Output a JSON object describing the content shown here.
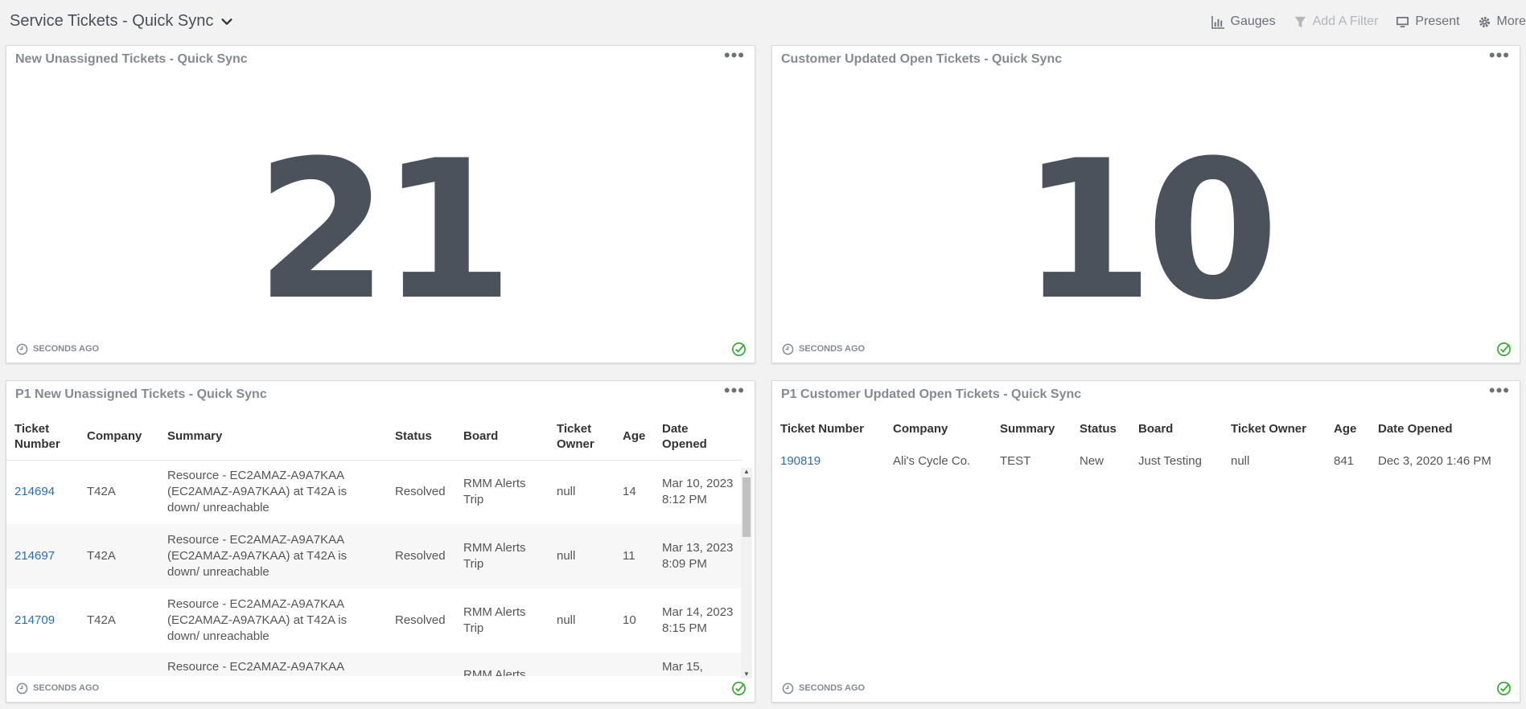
{
  "header": {
    "dashboard_title": "Service Tickets - Quick Sync",
    "toolbar": {
      "gauges": "Gauges",
      "add_filter": "Add A Filter",
      "present": "Present",
      "more": "More"
    }
  },
  "cards": {
    "new_unassigned": {
      "title": "New Unassigned Tickets - Quick Sync",
      "value": "21",
      "updated": "SECONDS AGO"
    },
    "customer_updated": {
      "title": "Customer Updated Open Tickets - Quick Sync",
      "value": "10",
      "updated": "SECONDS AGO"
    },
    "p1_new_unassigned": {
      "title": "P1 New Unassigned Tickets - Quick Sync",
      "updated": "SECONDS AGO",
      "columns": [
        "Ticket Number",
        "Company",
        "Summary",
        "Status",
        "Board",
        "Ticket Owner",
        "Age",
        "Date Opened"
      ],
      "rows": [
        [
          "214694",
          "T42A",
          "Resource - EC2AMAZ-A9A7KAA (EC2AMAZ-A9A7KAA) at T42A is down/ unreachable",
          "Resolved",
          "RMM Alerts Trip",
          "null",
          "14",
          "Mar 10, 2023 8:12 PM"
        ],
        [
          "214697",
          "T42A",
          "Resource - EC2AMAZ-A9A7KAA (EC2AMAZ-A9A7KAA) at T42A is down/ unreachable",
          "Resolved",
          "RMM Alerts Trip",
          "null",
          "11",
          "Mar 13, 2023 8:09 PM"
        ],
        [
          "214709",
          "T42A",
          "Resource - EC2AMAZ-A9A7KAA (EC2AMAZ-A9A7KAA) at T42A is down/ unreachable",
          "Resolved",
          "RMM Alerts Trip",
          "null",
          "10",
          "Mar 14, 2023 8:15 PM"
        ],
        [
          "",
          "",
          "Resource - EC2AMAZ-A9A7KAA",
          "",
          "RMM Alerts",
          "",
          "",
          "Mar 15,"
        ]
      ]
    },
    "p1_customer_updated": {
      "title": "P1 Customer Updated Open Tickets - Quick Sync",
      "updated": "SECONDS AGO",
      "columns": [
        "Ticket Number",
        "Company",
        "Summary",
        "Status",
        "Board",
        "Ticket Owner",
        "Age",
        "Date Opened"
      ],
      "rows": [
        [
          "190819",
          "Ali's Cycle Co.",
          "TEST",
          "New",
          "Just Testing",
          "null",
          "841",
          "Dec 3, 2020 1:46 PM"
        ]
      ]
    }
  },
  "colors": {
    "number": "#4b525b",
    "link": "#2a6fb0",
    "ok": "#3aaa35"
  }
}
